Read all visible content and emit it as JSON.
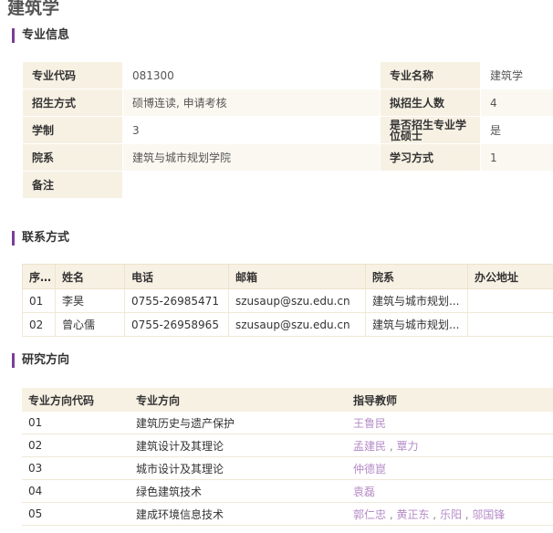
{
  "page": {
    "title": "建筑学"
  },
  "sections": {
    "info": "专业信息",
    "contact": "联系方式",
    "research": "研究方向"
  },
  "info": {
    "rows": [
      {
        "l1": "专业代码",
        "v1": "081300",
        "l2": "专业名称",
        "v2": "建筑学"
      },
      {
        "l1": "招生方式",
        "v1": "硕博连读, 申请考核",
        "l2": "拟招生人数",
        "v2": "4"
      },
      {
        "l1": "学制",
        "v1": "3",
        "l2": "是否招生专业学位硕士",
        "v2": "是"
      },
      {
        "l1": "院系",
        "v1": "建筑与城市规划学院",
        "l2": "学习方式",
        "v2": "1"
      },
      {
        "l1": "备注",
        "v1": ""
      }
    ]
  },
  "contact": {
    "headers": [
      "序...",
      "姓名",
      "电话",
      "邮箱",
      "院系",
      "办公地址"
    ],
    "rows": [
      {
        "no": "01",
        "name": "李昊",
        "phone": "0755-26985471",
        "email": "szusaup@szu.edu.cn",
        "dept": "建筑与城市规划...",
        "office": ""
      },
      {
        "no": "02",
        "name": "曾心儒",
        "phone": "0755-26958965",
        "email": "szusaup@szu.edu.cn",
        "dept": "建筑与城市规划...",
        "office": ""
      }
    ]
  },
  "research": {
    "headers": [
      "专业方向代码",
      "专业方向",
      "指导教师"
    ],
    "rows": [
      {
        "code": "01",
        "dir": "建筑历史与遗产保护",
        "teachers": [
          "王鲁民"
        ]
      },
      {
        "code": "02",
        "dir": "建筑设计及其理论",
        "teachers": [
          "孟建民",
          "覃力"
        ]
      },
      {
        "code": "03",
        "dir": "城市设计及其理论",
        "teachers": [
          "仲德崑"
        ]
      },
      {
        "code": "04",
        "dir": "绿色建筑技术",
        "teachers": [
          "袁磊"
        ]
      },
      {
        "code": "05",
        "dir": "建成环境信息技术",
        "teachers": [
          "郭仁忠",
          "黄正东",
          "乐阳",
          "邬国锋"
        ]
      }
    ]
  },
  "colors": {
    "accent": "#7b3f98",
    "header_bg": "#f7f1e4",
    "teacher_link": "#b58bc8"
  }
}
